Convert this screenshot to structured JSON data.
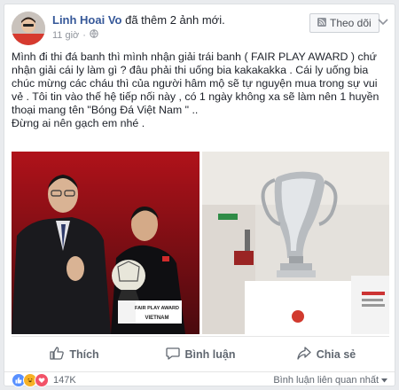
{
  "post": {
    "author": "Linh Hoai Vo",
    "action": "đã thêm 2 ảnh mới.",
    "time": "11 giờ",
    "follow_label": "Theo dõi",
    "text_lines": [
      "Mình đi thi đá banh thì mình nhận giải trái banh ( FAIR PLAY AWARD ) chứ",
      "nhận giải cái ly làm gì ? đâu phải thi uống bia kakakakka . Cái ly uống bia",
      "chúc mừng các cháu thì của người hâm mộ sẽ tự nguyện mua trong sự vui",
      "vẻ . Tôi tin vào thế hệ tiếp nối này , có 1 ngày không xa sẽ làm nên 1 huyền",
      "thoại mang tên \"Bóng Đá Việt Nam \" ..",
      "Đừng ai nên gạch em nhé ."
    ]
  },
  "photo1": {
    "sign_line1": "FAIR PLAY AWARD",
    "sign_line2": "VIETNAM"
  },
  "actions": {
    "like": "Thích",
    "comment": "Bình luận",
    "share": "Chia sẻ"
  },
  "footer": {
    "reaction_count": "147K",
    "sort_label": "Bình luận liên quan nhất"
  },
  "colors": {
    "link": "#365899",
    "like_blue": "#5890ff",
    "love_red": "#f25268",
    "haha_yellow": "#f7b125"
  }
}
